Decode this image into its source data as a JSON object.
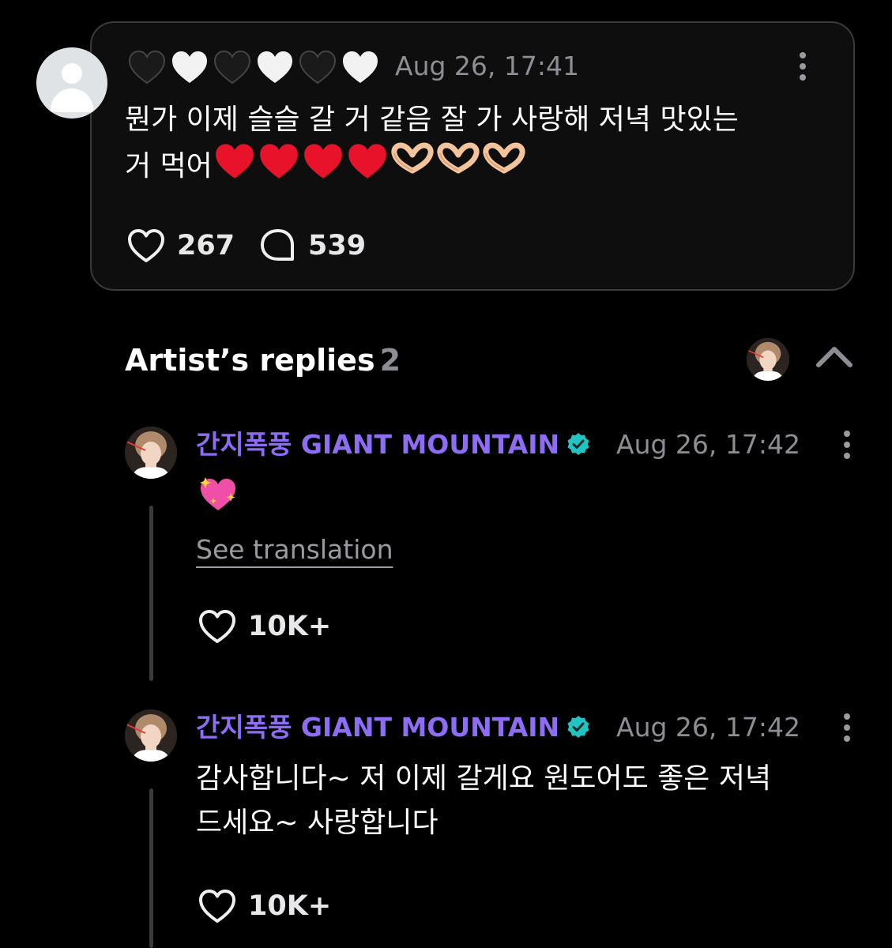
{
  "post": {
    "hearts": [
      "black-heart",
      "white-heart",
      "black-heart",
      "white-heart",
      "black-heart",
      "white-heart"
    ],
    "time": "Aug 26, 17:41",
    "text_line1": "뭔가 이제 슬슬 갈 거 같음 잘 가 사랑해 저녁 맛있는",
    "text_line2": "거 먹어",
    "trailing_emojis": [
      "red-heart",
      "red-heart",
      "red-heart",
      "red-heart",
      "heart-hands",
      "heart-hands",
      "heart-hands"
    ],
    "likes": "267",
    "comments": "539"
  },
  "replies": {
    "title": "Artist’s replies",
    "count": "2",
    "items": [
      {
        "author": "간지폭풍 GIANT MOUNTAIN",
        "time": "Aug 26, 17:42",
        "emoji": "sparkling-heart",
        "translate_label": "See translation",
        "likes": "10K+"
      },
      {
        "author": "간지폭풍 GIANT MOUNTAIN",
        "time": "Aug 26, 17:42",
        "text_line1": "감사합니다~ 저 이제 갈게요 원도어도 좋은 저녁",
        "text_line2": "드세요~ 사랑합니다",
        "likes": "10K+"
      }
    ]
  },
  "colors": {
    "background": "#000000",
    "card_border": "#3a3a3c",
    "artist_name": "#8e6cf3",
    "verified_badge": "#22c3c3",
    "muted_text": "#8d8d93"
  }
}
